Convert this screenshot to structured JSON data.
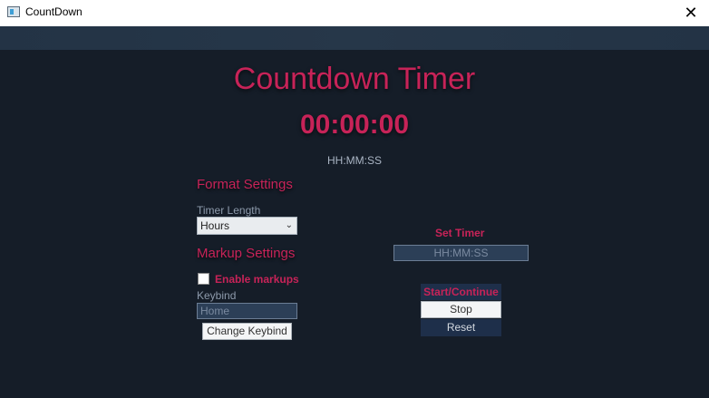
{
  "window": {
    "title": "CountDown",
    "close_glyph": "✕"
  },
  "main": {
    "heading": "Countdown Timer",
    "time_display": "00:00:00",
    "format_hint": "HH:MM:SS"
  },
  "format_settings": {
    "title": "Format Settings",
    "timer_length_label": "Timer Length",
    "timer_length_value": "Hours",
    "chevron_glyph": "⌄"
  },
  "markup_settings": {
    "title": "Markup Settings",
    "enable_label": "Enable markups",
    "enable_checked": false,
    "keybind_label": "Keybind",
    "keybind_placeholder": "Home",
    "change_keybind_label": "Change Keybind"
  },
  "set_timer": {
    "title": "Set Timer",
    "placeholder": "HH:MM:SS"
  },
  "controls": {
    "start_label": "Start/Continue",
    "stop_label": "Stop",
    "reset_label": "Reset"
  },
  "colors": {
    "accent": "#c72358",
    "background": "#151d28",
    "band": "#233345",
    "button_dark": "#1e2f4a"
  }
}
